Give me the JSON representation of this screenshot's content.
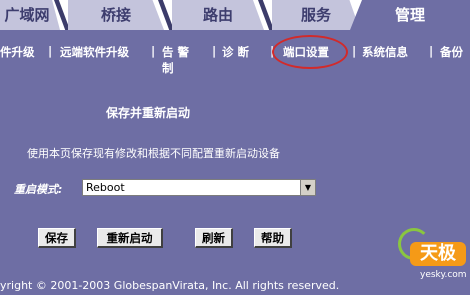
{
  "tabs": [
    {
      "label": "广域网"
    },
    {
      "label": "桥接"
    },
    {
      "label": "路由"
    },
    {
      "label": "服务"
    },
    {
      "label": "管理"
    }
  ],
  "subnav": [
    {
      "label": "件升级"
    },
    {
      "label": "远端软件升级"
    },
    {
      "label": "告 警"
    },
    {
      "label": "制"
    },
    {
      "label": "诊 断"
    },
    {
      "label": "端口设置"
    },
    {
      "label": "系统信息"
    },
    {
      "label": "备份"
    }
  ],
  "separator": "|",
  "main": {
    "title": "保存并重新启动",
    "description": "使用本页保存现有修改和根据不同配置重新启动设备",
    "mode_label": "重启模式:",
    "mode_value": "Reboot",
    "buttons": {
      "save": "保存",
      "restart": "重新启动",
      "refresh": "刷新",
      "help": "帮助"
    }
  },
  "footer": {
    "copyright": "yright © 2001-2003 GlobespanVirata, Inc. All rights reserved."
  },
  "watermark": {
    "logo": "天极",
    "site": "yesky.com"
  },
  "colors": {
    "page_bg": "#6e6ea4",
    "tab_inactive": "#c4c4dc",
    "highlight_circle": "#d22a2a"
  }
}
